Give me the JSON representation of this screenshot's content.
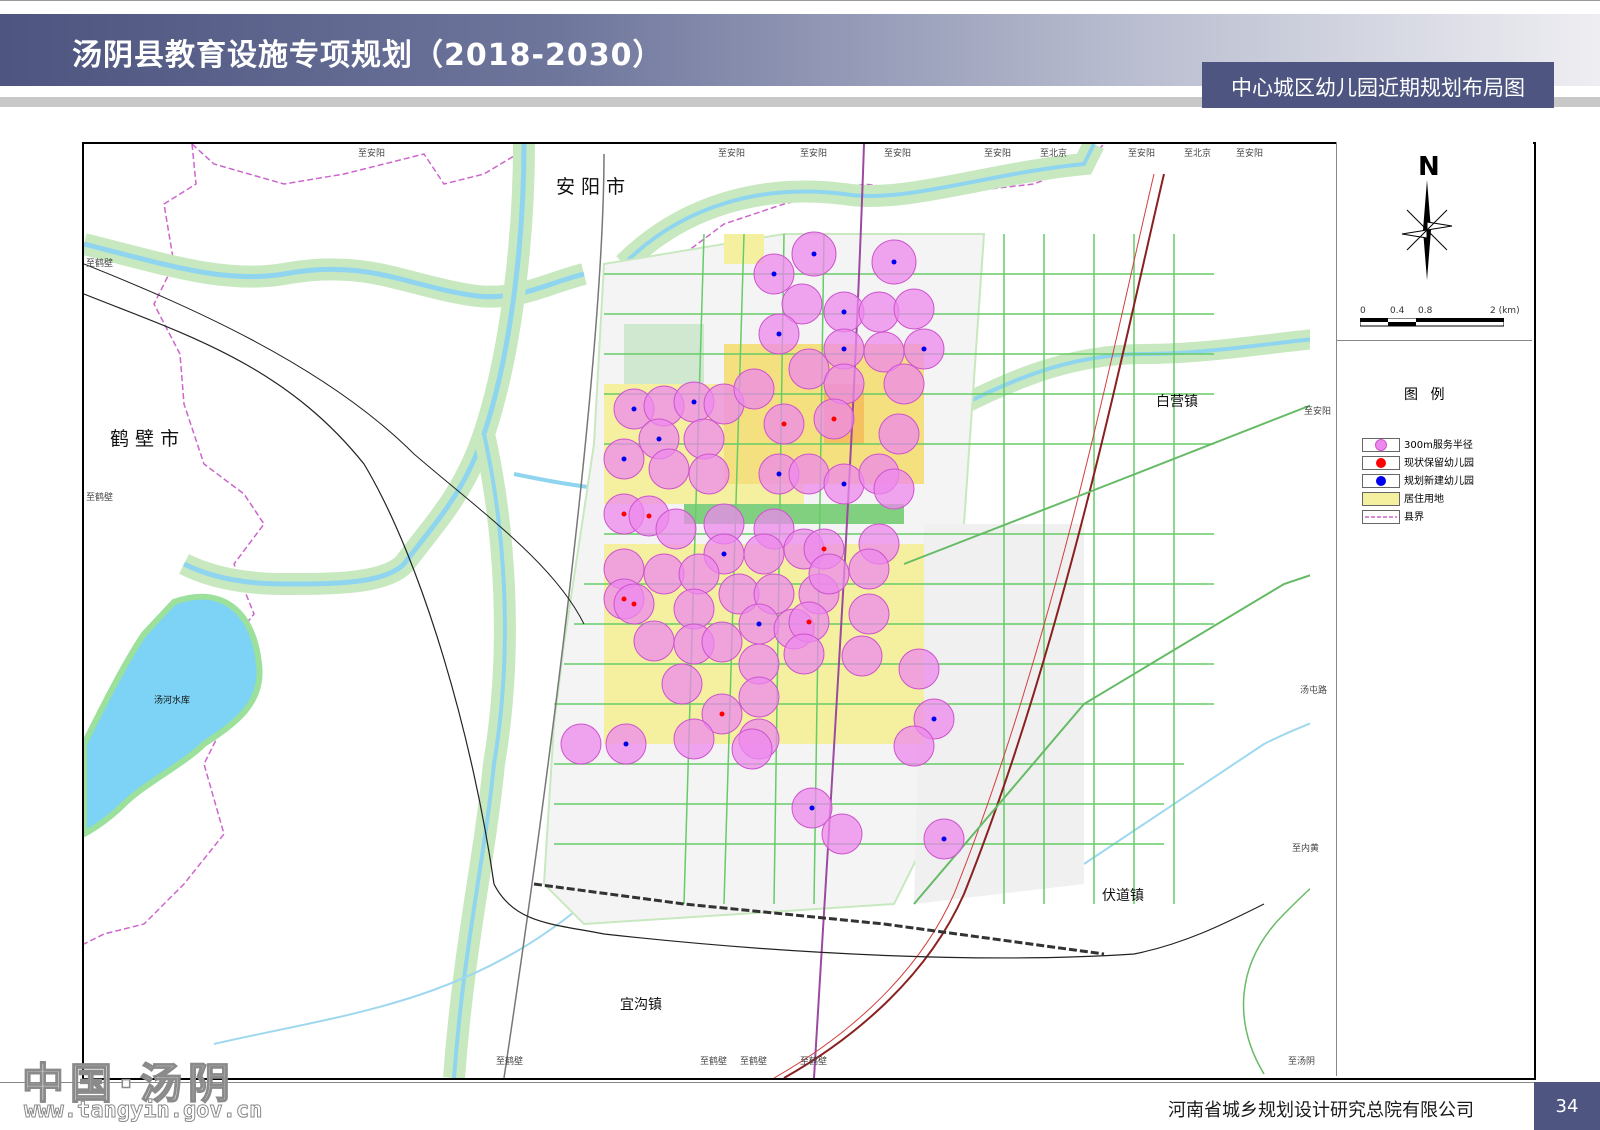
{
  "header": {
    "title": "汤阴县教育设施专项规划（2018-2030）",
    "sheet_title": "中心城区幼儿园近期规划布局图"
  },
  "map": {
    "places": {
      "anyang": "安 阳 市",
      "hebi": "鹤 壁 市",
      "baiying": "白营镇",
      "fudao": "伏道镇",
      "yigou": "宜沟镇",
      "reservoir": "汤河水库"
    },
    "north_label": "N",
    "scale": {
      "ticks": [
        "0",
        "0.4",
        "0.8",
        "2 (km)"
      ]
    },
    "road_labels": [
      "至安阳",
      "至安阳",
      "至安阳",
      "至安阳",
      "至安阳",
      "至北京",
      "至安阳",
      "至北京",
      "至安阳",
      "至鹤壁",
      "至鹤壁",
      "至安阳",
      "至鹤壁",
      "至鹤壁",
      "至鹤壁",
      "至鹤壁",
      "汤屯路",
      "至内黄",
      "至汤阴"
    ]
  },
  "legend": {
    "heading": "图 例",
    "items": [
      {
        "label": "300m服务半径",
        "color": "#ee88ee"
      },
      {
        "label": "现状保留幼儿园",
        "color": "#ff0000"
      },
      {
        "label": "规划新建幼儿园",
        "color": "#0000ee"
      },
      {
        "label": "居住用地",
        "color": "#f5f0a0"
      },
      {
        "label": "县界",
        "color": "#cc66cc"
      }
    ]
  },
  "footer": {
    "company": "河南省城乡规划设计研究总院有限公司",
    "page_number": "34"
  },
  "watermark": {
    "main": "中国·汤阴",
    "url": "www.tangyin.gov.cn"
  }
}
